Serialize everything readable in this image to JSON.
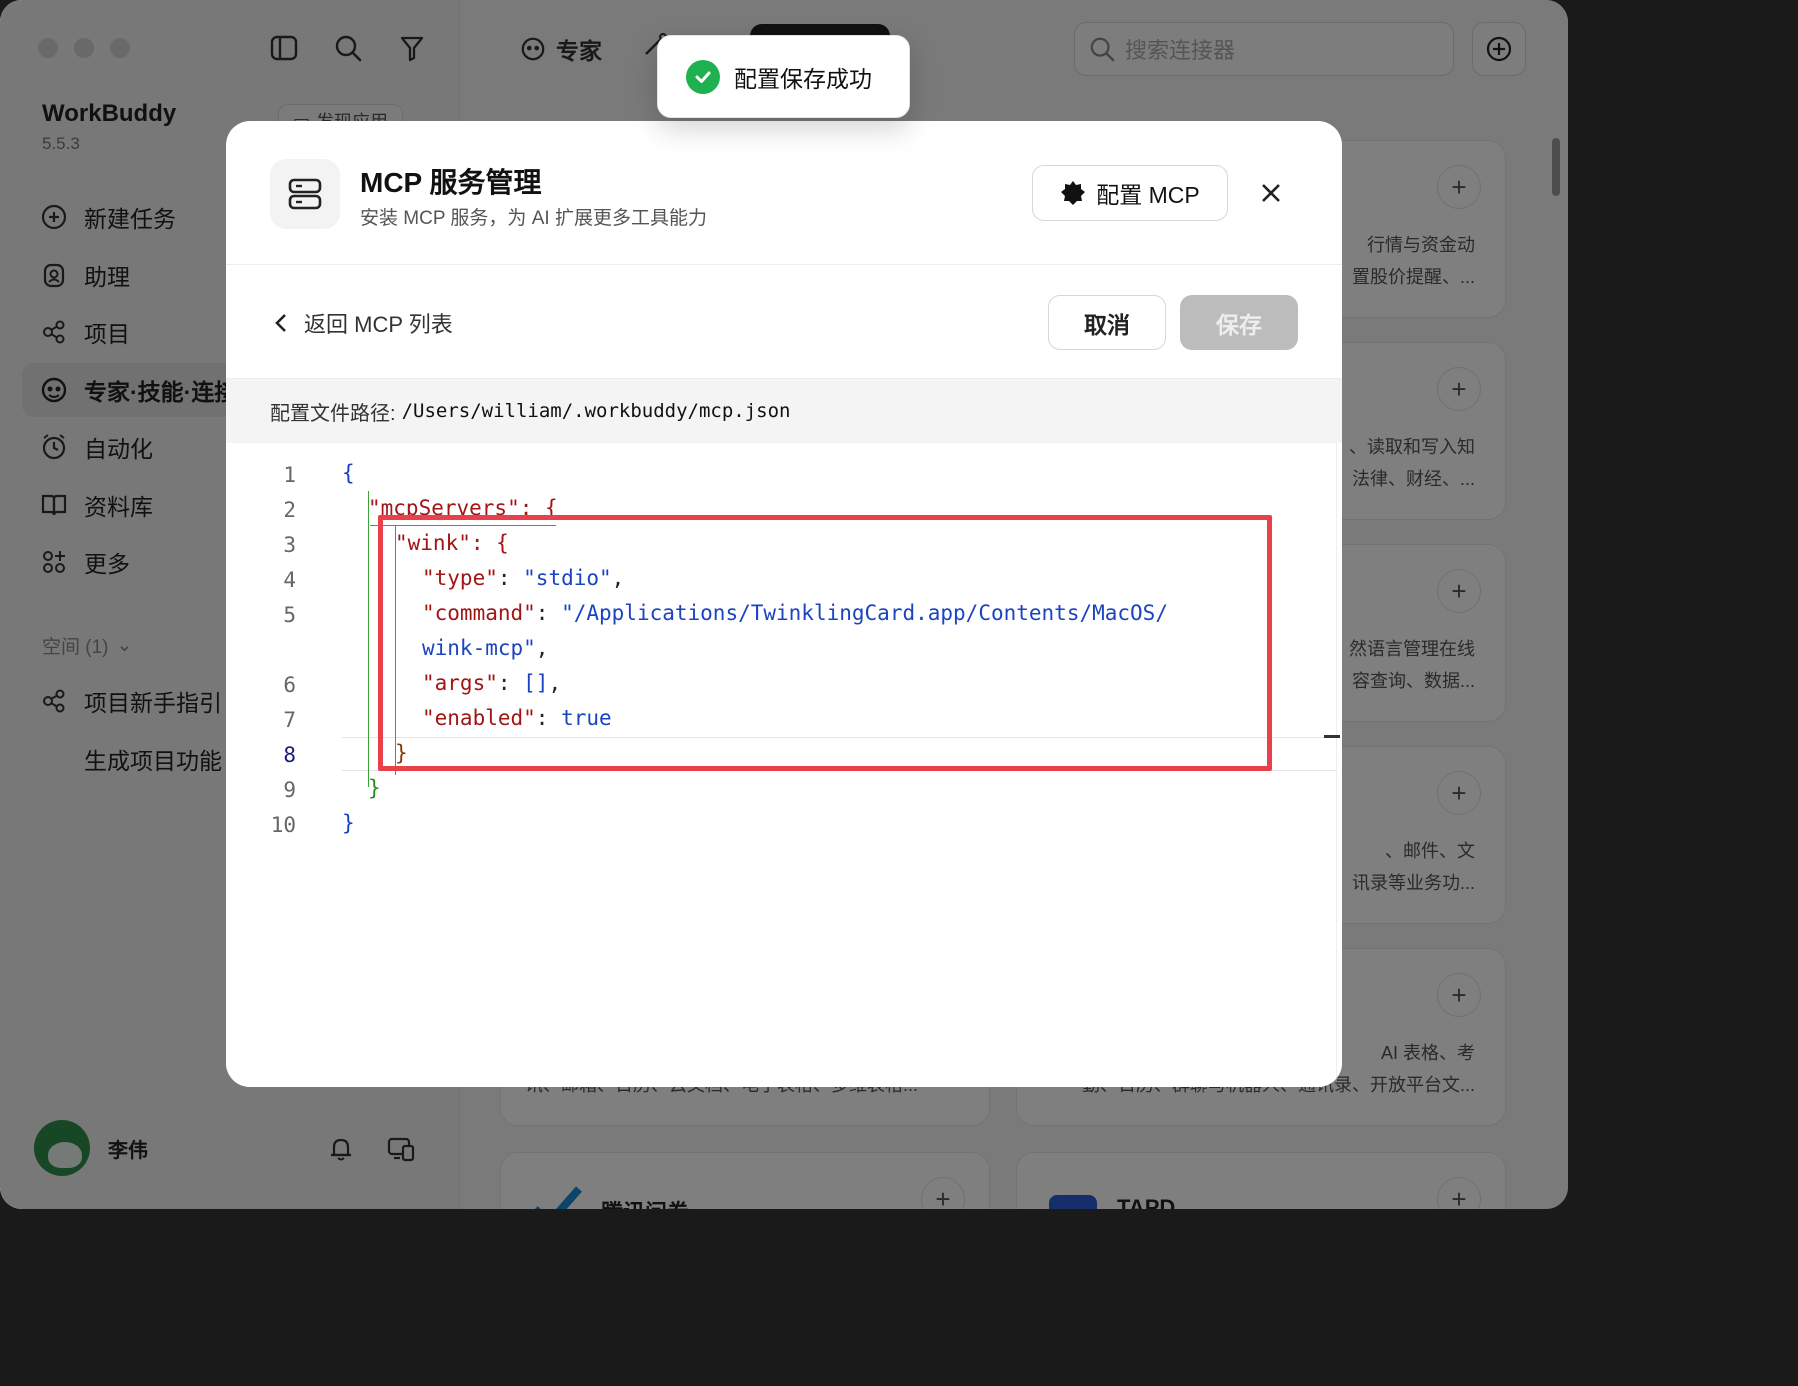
{
  "app": {
    "name": "WorkBuddy",
    "version": "5.5.3",
    "header_pill": "发现应用"
  },
  "sidebar": {
    "items": [
      {
        "label": "新建任务",
        "icon": "new-task-icon"
      },
      {
        "label": "助理",
        "icon": "assistant-icon"
      },
      {
        "label": "项目",
        "icon": "project-icon"
      },
      {
        "label": "专家·技能·连接器",
        "icon": "expert-icon",
        "active": true
      },
      {
        "label": "自动化",
        "icon": "automation-icon"
      },
      {
        "label": "资料库",
        "icon": "library-icon"
      },
      {
        "label": "更多",
        "icon": "more-icon"
      }
    ],
    "space_label": "空间 (1)",
    "space_items": [
      "项目新手指引",
      "生成项目功能"
    ],
    "user_name": "李伟"
  },
  "topbar": {
    "tab_expert": "专家",
    "search_placeholder": "搜索连接器"
  },
  "cards": [
    {
      "desc1": "行情与资金动",
      "desc2": "置股价提醒、..."
    },
    {
      "desc1": "、读取和写入知",
      "desc2": "法律、财经、..."
    },
    {
      "desc1": "然语言管理在线",
      "desc2": "容查询、数据..."
    },
    {
      "desc1": "、邮件、文",
      "desc2": "讯录等业务功..."
    },
    {
      "desc1": "AI 表格、考",
      "desc2": "勤、日历、群聊与机器人、通讯录、开放平台文..."
    },
    {
      "desc_left": "讯、邮箱、日历、云文档、电子表格、多维表格..."
    },
    {
      "title": "腾讯问卷"
    },
    {
      "title": "TAPD"
    }
  ],
  "toast": {
    "message": "配置保存成功"
  },
  "modal": {
    "title": "MCP 服务管理",
    "subtitle": "安装 MCP 服务，为 AI 扩展更多工具能力",
    "config_button": "配置 MCP",
    "back_label": "返回 MCP 列表",
    "cancel_label": "取消",
    "save_label": "保存",
    "path_label": "配置文件路径:",
    "path_value": "/Users/william/.workbuddy/mcp.json",
    "current_line": 8
  },
  "editor": {
    "lines": [
      {
        "n": "1",
        "text": "{"
      },
      {
        "n": "2",
        "text": "\"mcpServers\": {"
      },
      {
        "n": "3",
        "text": "\"wink\": {"
      },
      {
        "n": "4",
        "key": "\"type\"",
        "value": "\"stdio\"",
        "tail": ","
      },
      {
        "n": "5",
        "key": "\"command\"",
        "value": "\"/Applications/TwinklingCard.app/Contents/MacOS/"
      },
      {
        "n": "",
        "value": "wink-mcp\"",
        "tail": ","
      },
      {
        "n": "6",
        "key": "\"args\"",
        "value": "[]",
        "tail": ","
      },
      {
        "n": "7",
        "key": "\"enabled\"",
        "value": "true"
      },
      {
        "n": "8",
        "text": "}"
      },
      {
        "n": "9",
        "text": "}"
      },
      {
        "n": "10",
        "text": "}"
      }
    ]
  },
  "colors": {
    "accent_green": "#1fb14f",
    "highlight_red": "#e8414b",
    "json_key": "#a11515",
    "json_string": "#1a44c2"
  }
}
